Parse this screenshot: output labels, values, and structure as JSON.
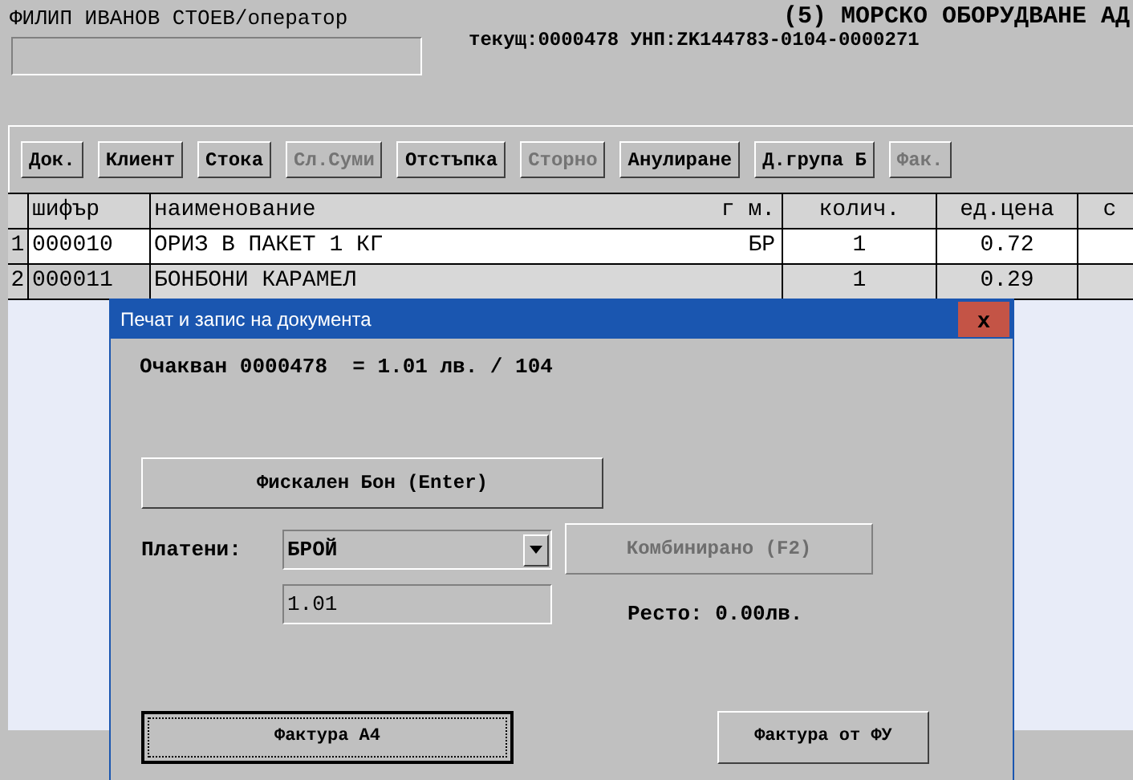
{
  "header": {
    "operator": "ФИЛИП ИВАНОВ СТОЕВ/оператор",
    "company": "(5) МОРСКО ОБОРУДВАНЕ АД",
    "document_info": "текущ:0000478 УНП:ZK144783-0104-0000271"
  },
  "toolbar": [
    {
      "label": "Док.",
      "disabled": false
    },
    {
      "label": "Клиент",
      "disabled": false
    },
    {
      "label": "Стока",
      "disabled": false
    },
    {
      "label": "Сл.Суми",
      "disabled": true
    },
    {
      "label": "Отстъпка",
      "disabled": false
    },
    {
      "label": "Сторно",
      "disabled": true
    },
    {
      "label": "Анулиране",
      "disabled": false
    },
    {
      "label": "Д.група Б",
      "disabled": false
    },
    {
      "label": "Фак.",
      "disabled": true
    }
  ],
  "table": {
    "columns": [
      "шифър",
      "наименование",
      "г м.",
      "колич.",
      "ед.цена",
      "с"
    ],
    "rows": [
      {
        "number": "1",
        "cells": [
          "000010",
          "ОРИЗ В ПАКЕТ 1 КГ",
          "БР",
          "1",
          "0.72"
        ],
        "selected": true
      },
      {
        "number": "2",
        "cells": [
          "000011",
          "БОНБОНИ КАРАМЕЛ",
          "",
          "1",
          "0.29"
        ],
        "selected": false
      }
    ]
  },
  "dialog": {
    "title": "Печат и запис на документа",
    "close": "x",
    "expected": "Очакван 0000478  = 1.01 лв. / 104",
    "fiscal_button": "Фискален Бон (Enter)",
    "paid_label": "Платени:",
    "payment_method": "БРОЙ",
    "combined_button": {
      "label": "Комбинирано (F2)",
      "disabled": true
    },
    "amount": "1.01",
    "change": "Ресто: 0.00лв.",
    "invoice_a4": "Фактура А4",
    "invoice_fu": "Фактура от ФУ"
  }
}
